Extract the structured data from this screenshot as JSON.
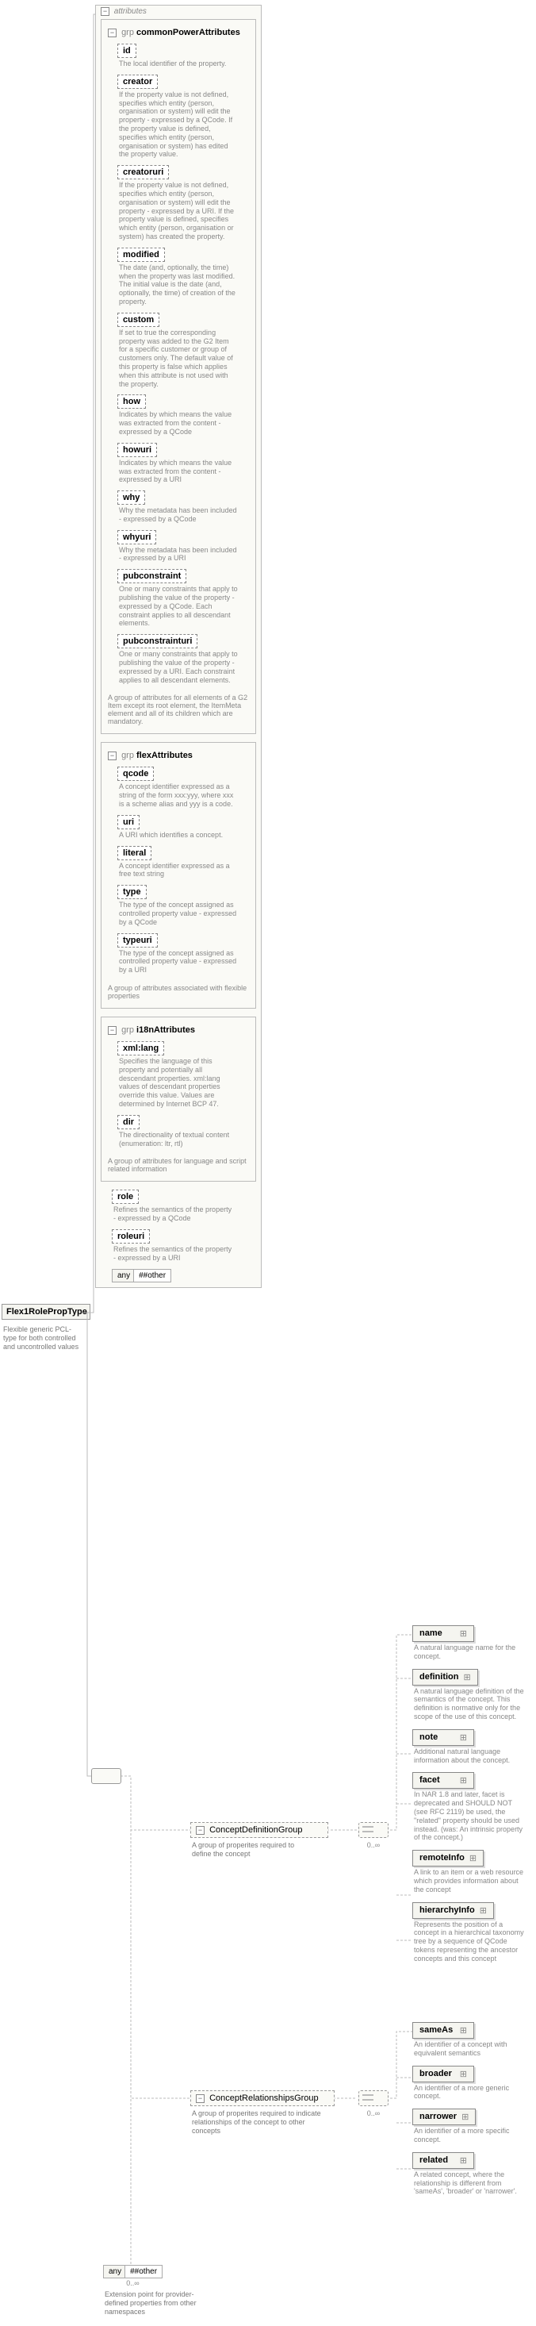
{
  "root": {
    "title": "Flex1RolePropType",
    "desc": "Flexible generic PCL-type for both controlled and uncontrolled values"
  },
  "attributes_header": "attributes",
  "toggle_minus": "−",
  "grp_prefix": "grp",
  "groups": {
    "common": {
      "title": "commonPowerAttributes",
      "desc": "A group of attributes for all elements of a G2 Item except its root element, the ItemMeta element and all of its children which are mandatory.",
      "attrs": [
        {
          "name": "id",
          "desc": "The local identifier of the property."
        },
        {
          "name": "creator",
          "desc": "If the property value is not defined, specifies which entity (person, organisation or system) will edit the property - expressed by a QCode. If the property value is defined, specifies which entity (person, organisation or system) has edited the property value."
        },
        {
          "name": "creatoruri",
          "desc": "If the property value is not defined, specifies which entity (person, organisation or system) will edit the property - expressed by a URI. If the property value is defined, specifies which entity (person, organisation or system) has created the property."
        },
        {
          "name": "modified",
          "desc": "The date (and, optionally, the time) when the property was last modified. The initial value is the date (and, optionally, the time) of creation of the property."
        },
        {
          "name": "custom",
          "desc": "If set to true the corresponding property was added to the G2 Item for a specific customer or group of customers only. The default value of this property is false which applies when this attribute is not used with the property."
        },
        {
          "name": "how",
          "desc": "Indicates by which means the value was extracted from the content - expressed by a QCode"
        },
        {
          "name": "howuri",
          "desc": "Indicates by which means the value was extracted from the content - expressed by a URI"
        },
        {
          "name": "why",
          "desc": "Why the metadata has been included - expressed by a QCode"
        },
        {
          "name": "whyuri",
          "desc": "Why the metadata has been included - expressed by a URI"
        },
        {
          "name": "pubconstraint",
          "desc": "One or many constraints that apply to publishing the value of the property - expressed by a QCode. Each constraint applies to all descendant elements."
        },
        {
          "name": "pubconstrainturi",
          "desc": "One or many constraints that apply to publishing the value of the property - expressed by a URI. Each constraint applies to all descendant elements."
        }
      ]
    },
    "flex": {
      "title": "flexAttributes",
      "desc": "A group of attributes associated with flexible properties",
      "attrs": [
        {
          "name": "qcode",
          "desc": "A concept identifier expressed as a string of the form xxx:yyy, where xxx is a scheme alias and yyy is a code."
        },
        {
          "name": "uri",
          "desc": "A URI which identifies a concept."
        },
        {
          "name": "literal",
          "desc": "A concept identifier expressed as a free text string"
        },
        {
          "name": "type",
          "desc": "The type of the concept assigned as controlled property value - expressed by a QCode"
        },
        {
          "name": "typeuri",
          "desc": "The type of the concept assigned as controlled property value - expressed by a URI"
        }
      ]
    },
    "i18n": {
      "title": "i18nAttributes",
      "desc": "A group of attributes for language and script related information",
      "attrs": [
        {
          "name": "xml:lang",
          "desc": "Specifies the language of this property and potentially all descendant properties. xml:lang values of descendant properties override this value. Values are determined by Internet BCP 47."
        },
        {
          "name": "dir",
          "desc": "The directionality of textual content (enumeration: ltr, rtl)"
        }
      ]
    }
  },
  "extra_attrs": [
    {
      "name": "role",
      "desc": "Refines the semantics of the property - expressed by a QCode"
    },
    {
      "name": "roleuri",
      "desc": "Refines the semantics of the property - expressed by a URI"
    }
  ],
  "any_attr": {
    "label": "any",
    "ns": "##other"
  },
  "cdg": {
    "title": "ConceptDefinitionGroup",
    "desc": "A group of properites required to define the concept",
    "items": [
      {
        "name": "name",
        "desc": "A natural language name for the concept."
      },
      {
        "name": "definition",
        "desc": "A natural language definition of the semantics of the concept. This definition is normative only for the scope of the use of this concept."
      },
      {
        "name": "note",
        "desc": "Additional natural language information about the concept."
      },
      {
        "name": "facet",
        "desc": "In NAR 1.8 and later, facet is deprecated and SHOULD NOT (see RFC 2119) be used, the \"related\" property should be used instead. (was: An intrinsic property of the concept.)"
      },
      {
        "name": "remoteInfo",
        "desc": "A link to an item or a web resource which provides information about the concept"
      },
      {
        "name": "hierarchyInfo",
        "desc": "Represents the position of a concept in a hierarchical taxonomy tree by a sequence of QCode tokens representing the ancestor concepts and this concept"
      }
    ]
  },
  "crg": {
    "title": "ConceptRelationshipsGroup",
    "desc": "A group of properites required to indicate relationships of the concept to other concepts",
    "items": [
      {
        "name": "sameAs",
        "desc": "An identifier of a concept with equivalent semantics"
      },
      {
        "name": "broader",
        "desc": "An identifier of a more generic concept."
      },
      {
        "name": "narrower",
        "desc": "An identifier of a more specific concept."
      },
      {
        "name": "related",
        "desc": "A related concept, where the relationship is different from 'sameAs', 'broader' or 'narrower'."
      }
    ]
  },
  "any_elem": {
    "label": "any",
    "ns": "##other",
    "occur": "0..∞",
    "desc": "Extension point for provider-defined properties from other namespaces"
  },
  "seq_occur_1": "0..∞",
  "choice_occur": "0..∞"
}
